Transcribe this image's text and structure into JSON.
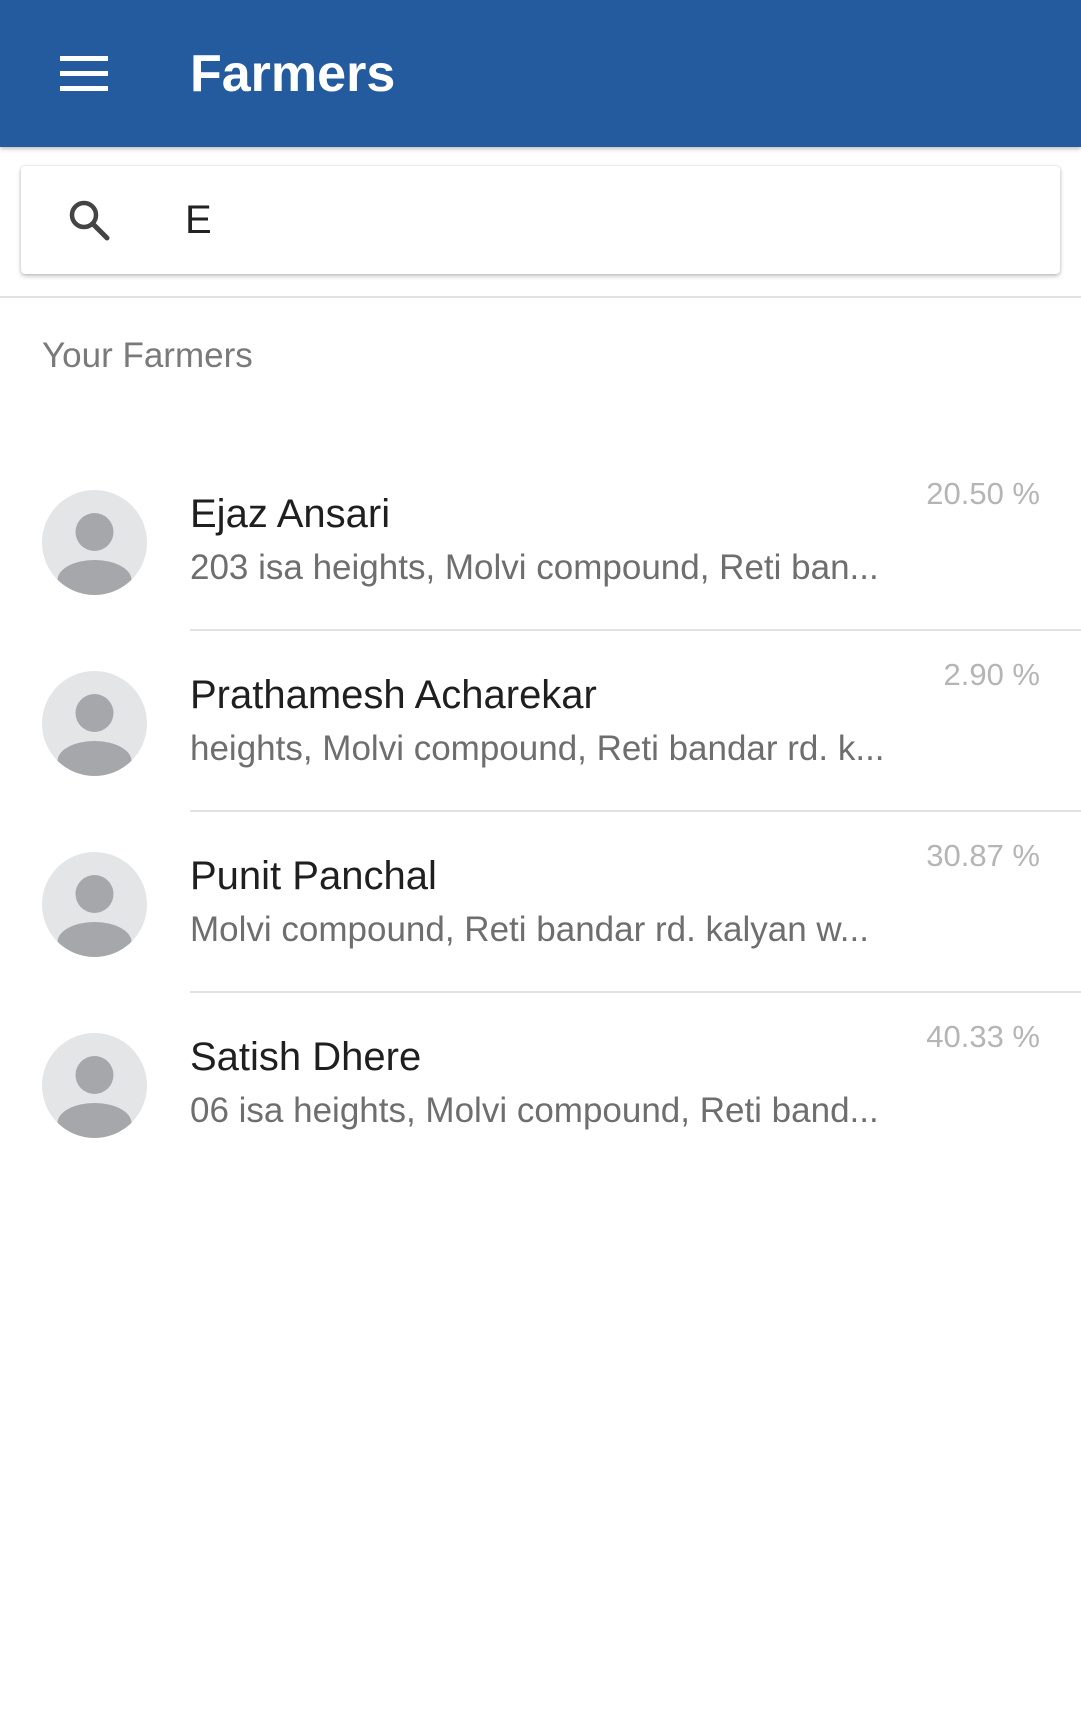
{
  "appbar": {
    "title": "Farmers",
    "menu_icon": "hamburger-menu-icon",
    "color": "#245b9f"
  },
  "search": {
    "icon": "search-icon",
    "value": "E",
    "placeholder": ""
  },
  "section": {
    "header": "Your Farmers"
  },
  "farmers": [
    {
      "name": "Ejaz Ansari",
      "address": "203 isa heights, Molvi compound, Reti ban...",
      "percent": "20.50 %",
      "avatar_icon": "person-avatar-icon"
    },
    {
      "name": "Prathamesh Acharekar",
      "address": "heights, Molvi compound, Reti bandar rd. k...",
      "percent": "2.90 %",
      "avatar_icon": "person-avatar-icon"
    },
    {
      "name": "Punit Panchal",
      "address": "Molvi compound, Reti bandar rd. kalyan w...",
      "percent": "30.87 %",
      "avatar_icon": "person-avatar-icon"
    },
    {
      "name": "Satish Dhere",
      "address": "06 isa heights, Molvi compound, Reti band...",
      "percent": "40.33 %",
      "avatar_icon": "person-avatar-icon"
    }
  ]
}
